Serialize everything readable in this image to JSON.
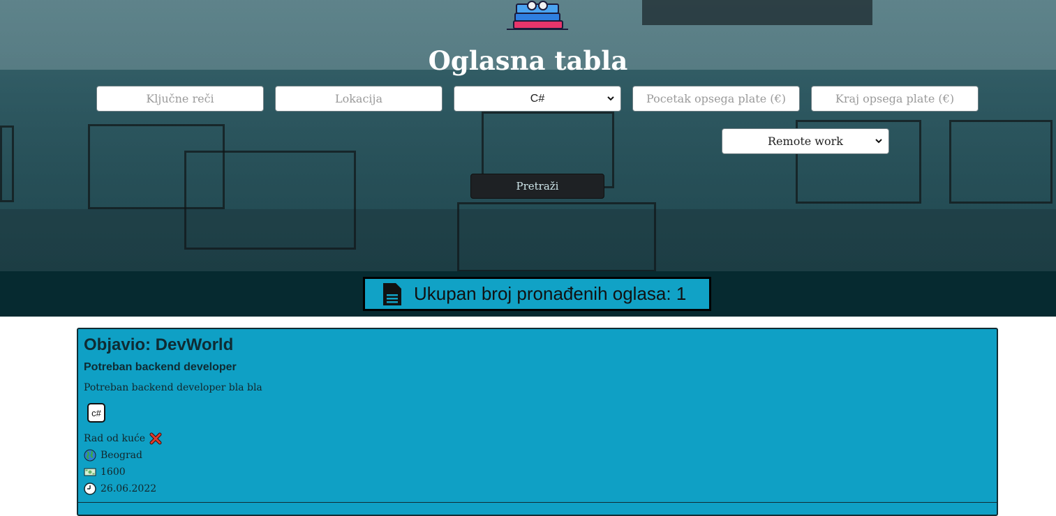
{
  "header": {
    "title": "Oglasna tabla"
  },
  "filters": {
    "keywords_placeholder": "Ključne reči",
    "location_placeholder": "Lokacija",
    "technology_selected": "C#",
    "salary_from_placeholder": "Pocetak opsega plate (€)",
    "salary_to_placeholder": "Kraj opsega plate (€)",
    "remote_selected": "Remote work",
    "search_label": "Pretraži"
  },
  "results": {
    "count_text": "Ukupan broj pronađenih oglasa: 1"
  },
  "listings": [
    {
      "publisher": "Objavio: DevWorld",
      "title": "Potreban backend developer",
      "description": "Potreban backend developer bla bla",
      "tag": "c#",
      "remote_label": "Rad od kuće",
      "city": "Beograd",
      "salary": "1600",
      "date": "26.06.2022"
    }
  ],
  "colors": {
    "accent": "#11a2c6",
    "count_bar_bg": "#062a30",
    "button_bg": "#1e2124",
    "card_bg": "#0fa0c5"
  }
}
